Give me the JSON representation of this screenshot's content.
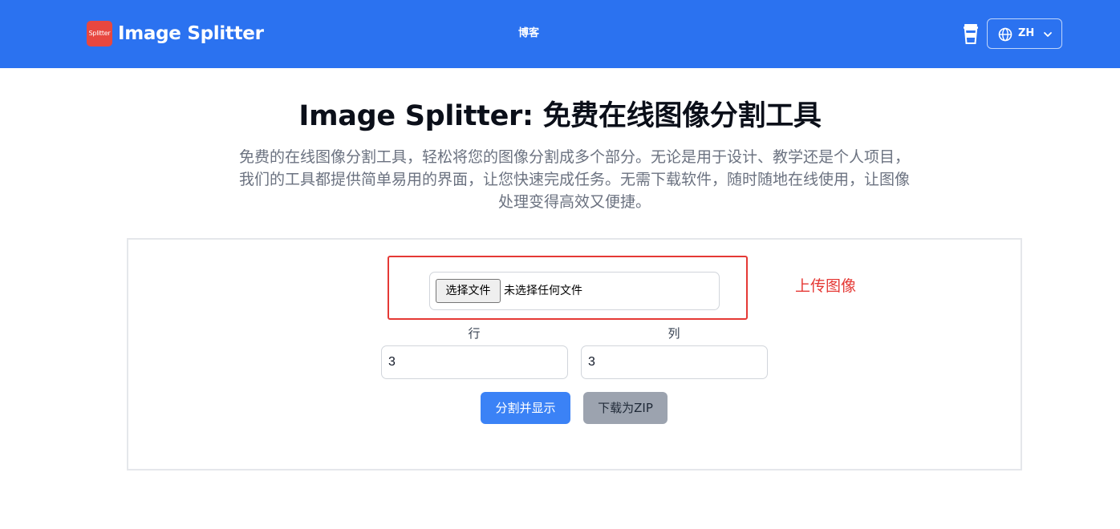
{
  "header": {
    "logo_badge": "Splitter",
    "brand": "Image Splitter",
    "nav_blog": "博客",
    "lang_label": "ZH"
  },
  "hero": {
    "title": "Image Splitter: 免费在线图像分割工具",
    "description_line1": "免费的在线图像分割工具，轻松将您的图像分割成多个部分。无论是用于设计、教学还是个人项目，",
    "description_line2": "我们的工具都提供简单易用的界面，让您快速完成任务。无需下载软件，随时随地在线使用，让图像",
    "description_line3": "处理变得高效又便捷。"
  },
  "tool": {
    "file_button_label": "选择文件",
    "file_status": "未选择任何文件",
    "annotation": "上传图像",
    "rows_label": "行",
    "rows_value": "3",
    "cols_label": "列",
    "cols_value": "3",
    "split_button": "分割并显示",
    "zip_button": "下载为ZIP"
  },
  "colors": {
    "header_bg": "#2b72f0",
    "logo_badge_bg": "#e8473f",
    "primary_button": "#3b82f6",
    "disabled_button": "#9ca3af",
    "annotation_red": "#e53935"
  },
  "icons": {
    "cup": "coffee-cup-icon",
    "globe": "globe-icon",
    "chevron": "chevron-down-icon"
  }
}
